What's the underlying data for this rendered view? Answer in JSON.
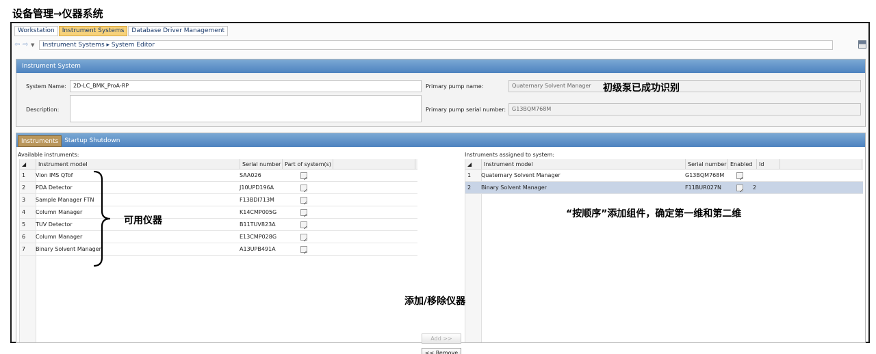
{
  "caption": "设备管理→仪器系统",
  "tabs": [
    "Workstation",
    "Instrument Systems",
    "Database Driver Management"
  ],
  "breadcrumb": "Instrument Systems ▸ System Editor",
  "instrument_system": {
    "header": "Instrument System",
    "system_name_label": "System Name:",
    "system_name_value": "2D-LC_BMK_ProA-RP",
    "description_label": "Description:",
    "description_value": "",
    "primary_pump_name_label": "Primary pump name:",
    "primary_pump_name_value": "Quaternary Solvent Manager",
    "primary_pump_serial_label": "Primary pump serial number:",
    "primary_pump_serial_value": "G13BQM768M"
  },
  "section_tabs": [
    "Instruments",
    "Startup Shutdown"
  ],
  "available": {
    "title": "Available instruments:",
    "columns": [
      "Instrument model",
      "Serial number",
      "Part of system(s)"
    ],
    "rows": [
      {
        "idx": "1",
        "model": "Vion IMS QTof",
        "serial": "SAA026",
        "part": "✓"
      },
      {
        "idx": "2",
        "model": "PDA Detector",
        "serial": "J10UPD196A",
        "part": "✓"
      },
      {
        "idx": "3",
        "model": "Sample Manager FTN",
        "serial": "F13BDI713M",
        "part": "✓"
      },
      {
        "idx": "4",
        "model": "Column Manager",
        "serial": "K14CMP005G",
        "part": "✓"
      },
      {
        "idx": "5",
        "model": "TUV Detector",
        "serial": "B11TUV823A",
        "part": "✓"
      },
      {
        "idx": "6",
        "model": "Column Manager",
        "serial": "E13CMP028G",
        "part": "✓"
      },
      {
        "idx": "7",
        "model": "Binary Solvent Manager",
        "serial": "A13UPB491A",
        "part": "✓"
      }
    ]
  },
  "assigned": {
    "title": "Instruments assigned to system:",
    "columns": [
      "Instrument model",
      "Serial number",
      "Enabled",
      "Id"
    ],
    "rows": [
      {
        "idx": "1",
        "model": "Quaternary Solvent Manager",
        "serial": "G13BQM768M",
        "enabled": "✓",
        "id": ""
      },
      {
        "idx": "2",
        "model": "Binary Solvent Manager",
        "serial": "F11BUR027N",
        "enabled": "✓",
        "id": "2"
      }
    ]
  },
  "buttons": {
    "add": "Add >>",
    "remove": "<< Remove"
  },
  "annotations": {
    "pump_identified": "初级泵已成功识别",
    "available_instruments": "可用仪器",
    "order_note": "“按顺序”添加组件，确定第一维和第二维",
    "add_remove": "添加/移除仪器"
  },
  "colors": {
    "active_tab": "#f7d27b",
    "header_blue": "#4d82bf",
    "selected_row": "#c8d4e6"
  }
}
